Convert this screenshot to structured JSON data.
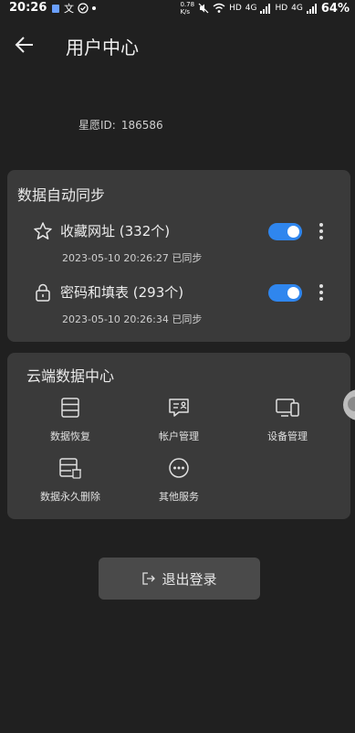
{
  "status_bar": {
    "time": "20:26",
    "net_speed": "0.78\nK/s",
    "hd1": "HD",
    "sig1": "4G",
    "hd2": "HD",
    "sig2": "4G",
    "battery": "64%"
  },
  "header": {
    "title": "用户中心"
  },
  "user": {
    "id_label": "星愿ID:",
    "id_value": "186586"
  },
  "sync": {
    "title": "数据自动同步",
    "items": [
      {
        "label": "收藏网址 (332个)",
        "timestamp": "2023-05-10 20:26:27 已同步",
        "enabled": true,
        "icon": "star-icon"
      },
      {
        "label": "密码和填表 (293个)",
        "timestamp": "2023-05-10 20:26:34 已同步",
        "enabled": true,
        "icon": "lock-icon"
      }
    ]
  },
  "cloud": {
    "title": "云端数据中心",
    "items": [
      {
        "label": "数据恢复",
        "icon": "data-restore-icon"
      },
      {
        "label": "帐户管理",
        "icon": "account-manage-icon"
      },
      {
        "label": "设备管理",
        "icon": "device-manage-icon"
      },
      {
        "label": "数据永久删除",
        "icon": "data-delete-icon"
      },
      {
        "label": "其他服务",
        "icon": "more-services-icon"
      }
    ]
  },
  "logout": {
    "label": "退出登录",
    "icon": "logout-icon"
  },
  "colors": {
    "accent": "#2f86ee",
    "card": "#3a3a3a",
    "background": "#202020"
  }
}
